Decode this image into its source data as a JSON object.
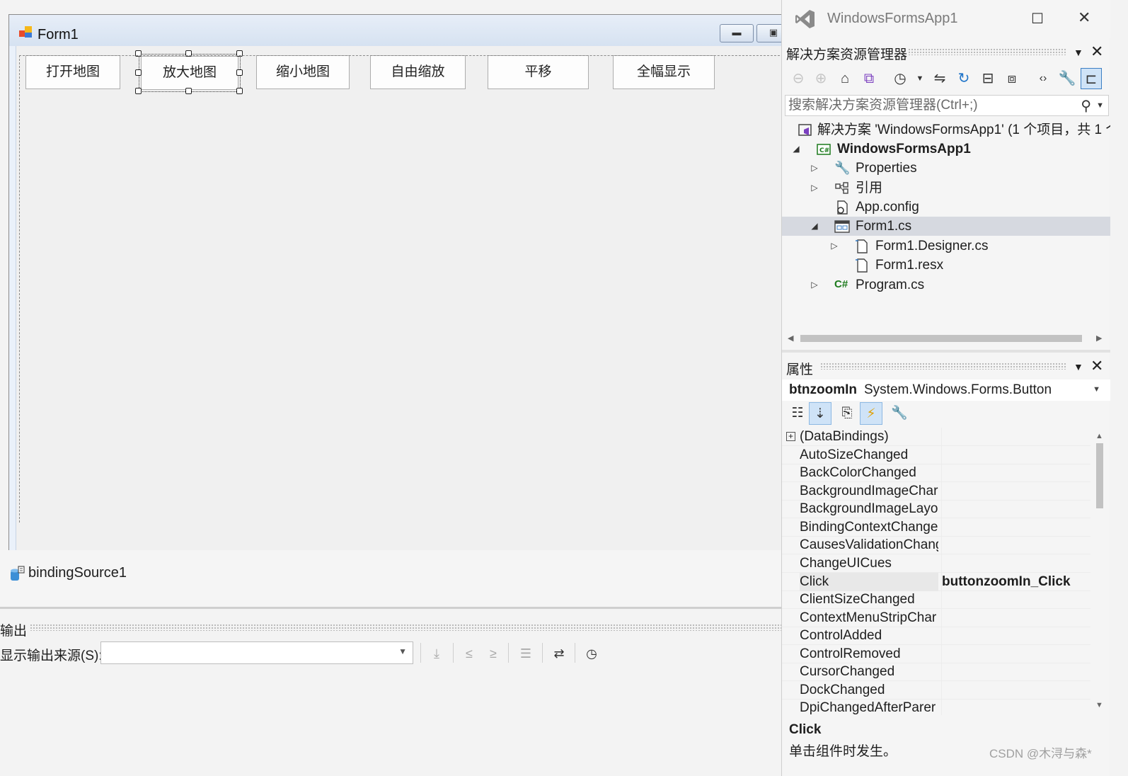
{
  "designer": {
    "form_title": "Form1",
    "toolbar_buttons": [
      "打开地图",
      "放大地图",
      "缩小地图",
      "自由缩放",
      "平移",
      "全幅显示"
    ],
    "selected_button_index": 1,
    "component_tray": {
      "component": "bindingSource1"
    }
  },
  "output": {
    "title": "输出",
    "source_label": "显示输出来源(S):",
    "source_value": ""
  },
  "vs": {
    "window_title": "WindowsFormsApp1",
    "max_icon": "☐",
    "close_icon": "✕"
  },
  "solution_explorer": {
    "title": "解决方案资源管理器",
    "search_placeholder": "搜索解决方案资源管理器(Ctrl+;)",
    "tree": [
      {
        "label": "解决方案 'WindowsFormsApp1' (1 个项目，共 1 个",
        "icon": "solution-icon",
        "expander": "",
        "bold": false
      },
      {
        "label": "WindowsFormsApp1",
        "icon": "csharp-project-icon",
        "expander": "◢",
        "bold": true
      },
      {
        "label": "Properties",
        "icon": "wrench-icon",
        "expander": "▷",
        "bold": false
      },
      {
        "label": "引用",
        "icon": "references-icon",
        "expander": "▷",
        "bold": false
      },
      {
        "label": "App.config",
        "icon": "config-file-icon",
        "expander": "",
        "bold": false
      },
      {
        "label": "Form1.cs",
        "icon": "form-icon",
        "expander": "◢",
        "bold": false,
        "selected": true
      },
      {
        "label": "Form1.Designer.cs",
        "icon": "file-icon",
        "expander": "▷",
        "bold": false
      },
      {
        "label": "Form1.resx",
        "icon": "file-icon",
        "expander": "",
        "bold": false
      },
      {
        "label": "Program.cs",
        "icon": "csharp-file-icon",
        "expander": "▷",
        "bold": false
      }
    ]
  },
  "properties": {
    "title": "属性",
    "object_name": "btnzoomIn",
    "object_type": "System.Windows.Forms.Button",
    "rows": [
      {
        "name": "(DataBindings)",
        "value": ""
      },
      {
        "name": "AutoSizeChanged",
        "value": ""
      },
      {
        "name": "BackColorChanged",
        "value": ""
      },
      {
        "name": "BackgroundImageChar",
        "value": ""
      },
      {
        "name": "BackgroundImageLayo",
        "value": ""
      },
      {
        "name": "BindingContextChange",
        "value": ""
      },
      {
        "name": "CausesValidationChang",
        "value": ""
      },
      {
        "name": "ChangeUICues",
        "value": ""
      },
      {
        "name": "Click",
        "value": "buttonzoomIn_Click",
        "selected": true
      },
      {
        "name": "ClientSizeChanged",
        "value": ""
      },
      {
        "name": "ContextMenuStripChar",
        "value": ""
      },
      {
        "name": "ControlAdded",
        "value": ""
      },
      {
        "name": "ControlRemoved",
        "value": ""
      },
      {
        "name": "CursorChanged",
        "value": ""
      },
      {
        "name": "DockChanged",
        "value": ""
      },
      {
        "name": "DpiChangedAfterParer",
        "value": ""
      }
    ],
    "description_title": "Click",
    "description_text": "单击组件时发生。"
  },
  "watermark": "CSDN @木浔与森*",
  "colors": {
    "accent": "#3c7fc4",
    "selection": "#d6d9e0",
    "event_active": "#cfe3f7"
  }
}
